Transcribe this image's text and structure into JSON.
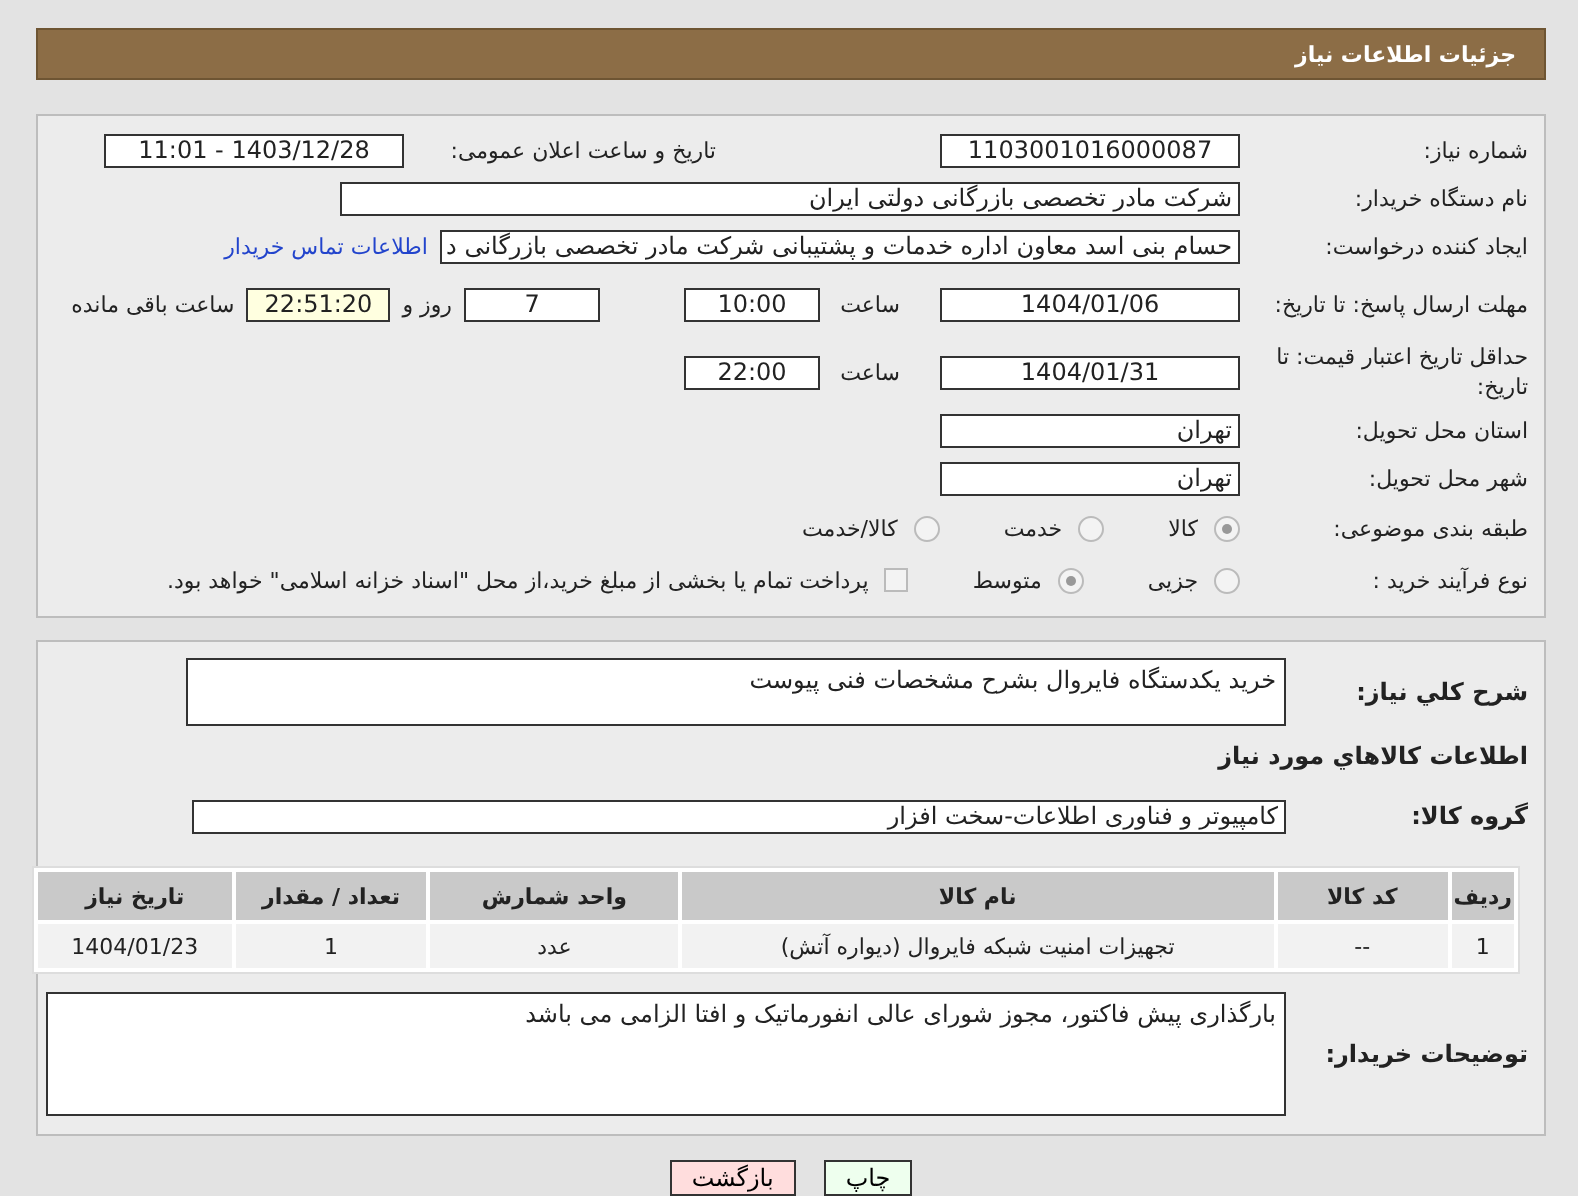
{
  "header": {
    "title": "جزئیات اطلاعات نیاز"
  },
  "details": {
    "need_number": {
      "label": "شماره نیاز:",
      "value": "1103001016000087"
    },
    "announce": {
      "label": "تاریخ و ساعت اعلان عمومی:",
      "value": "1403/12/28 - 11:01"
    },
    "buyer": {
      "label": "نام دستگاه خریدار:",
      "value": "شرکت مادر تخصصی بازرگانی دولتی ایران"
    },
    "creator": {
      "label": "ایجاد کننده درخواست:",
      "value": "حسام بنی اسد معاون اداره خدمات و پشتیبانی شرکت مادر تخصصی بازرگانی د",
      "link": "اطلاعات تماس خریدار"
    },
    "deadline": {
      "label": "مهلت ارسال پاسخ: تا تاریخ:",
      "date": "1404/01/06",
      "time_label": "ساعت",
      "time": "10:00",
      "days": "7",
      "days_label": "روز و",
      "remaining": "22:51:20",
      "remaining_label": "ساعت باقی مانده"
    },
    "validity": {
      "label": "حداقل تاریخ اعتبار قیمت: تا تاریخ:",
      "date": "1404/01/31",
      "time_label": "ساعت",
      "time": "22:00"
    },
    "province": {
      "label": "استان محل تحویل:",
      "value": "تهران"
    },
    "city": {
      "label": "شهر محل تحویل:",
      "value": "تهران"
    },
    "category": {
      "label": "طبقه بندی موضوعی:",
      "options": [
        {
          "label": "کالا",
          "selected": true
        },
        {
          "label": "خدمت",
          "selected": false
        },
        {
          "label": "کالا/خدمت",
          "selected": false
        }
      ]
    },
    "process": {
      "label": "نوع فرآیند خرید :",
      "options": [
        {
          "label": "جزیی",
          "selected": false
        },
        {
          "label": "متوسط",
          "selected": true
        }
      ],
      "treasury": {
        "label": "پرداخت تمام یا بخشی از مبلغ خرید،از محل \"اسناد خزانه اسلامی\" خواهد بود.",
        "checked": false
      }
    }
  },
  "summary": {
    "label": "شرح کلي نياز:",
    "value": "خرید یکدستگاه فایروال بشرح مشخصات فنی پیوست"
  },
  "goods_heading": "اطلاعات کالاهاي مورد نياز",
  "goods_group": {
    "label": "گروه کالا:",
    "value": "کامپیوتر و فناوری اطلاعات-سخت افزار"
  },
  "table": {
    "columns": [
      "ردیف",
      "کد کالا",
      "نام کالا",
      "واحد شمارش",
      "تعداد / مقدار",
      "تاریخ نیاز"
    ],
    "rows": [
      [
        "1",
        "--",
        "تجهیزات امنیت شبکه فایروال (دیواره آتش)",
        "عدد",
        "1",
        "1404/01/23"
      ]
    ]
  },
  "buyer_notes": {
    "label": "توضیحات خریدار:",
    "value": "بارگذاری پیش فاکتور، مجوز شورای عالی انفورماتیک و افتا الزامی می باشد"
  },
  "buttons": [
    {
      "label": "چاپ",
      "kind": "print"
    },
    {
      "label": "بازگشت",
      "kind": "back"
    }
  ]
}
